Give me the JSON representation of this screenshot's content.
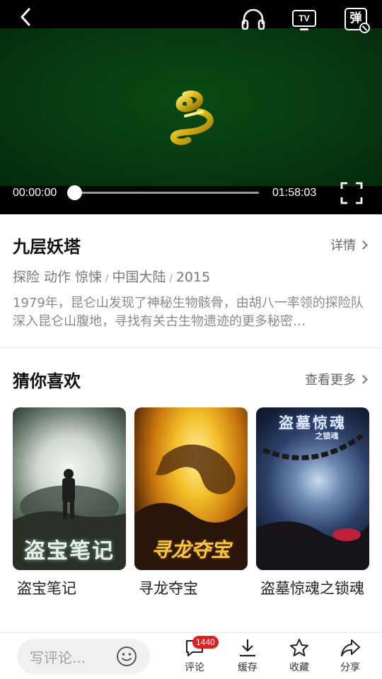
{
  "player": {
    "current_time": "00:00:00",
    "duration": "01:58:03",
    "progress": 0,
    "tv_label": "TV",
    "danmaku_label": "弹"
  },
  "movie": {
    "title": "九层妖塔",
    "detail_link": "详情",
    "genres": [
      "探险",
      "动作",
      "惊悚"
    ],
    "region": "中国大陆",
    "year": "2015",
    "description": "1979年，昆仑山发现了神秘生物骸骨，由胡八一率领的探险队深入昆仑山腹地，寻找有关古生物遗迹的更多秘密…"
  },
  "recommend": {
    "title": "猜你喜欢",
    "more_link": "查看更多",
    "items": [
      {
        "name": "盗宝笔记",
        "poster_text": "盗宝笔记"
      },
      {
        "name": "寻龙夺宝",
        "poster_text": "寻龙夺宝"
      },
      {
        "name": "盗墓惊魂之锁魂",
        "poster_text": "盗墓惊魂",
        "poster_subtext": "之锁魂"
      }
    ]
  },
  "bottom_bar": {
    "comment_placeholder": "写评论...",
    "actions": [
      {
        "label": "评论",
        "icon": "comment-icon",
        "badge": "1440"
      },
      {
        "label": "缓存",
        "icon": "download-icon"
      },
      {
        "label": "收藏",
        "icon": "star-icon"
      },
      {
        "label": "分享",
        "icon": "share-icon"
      }
    ]
  },
  "colors": {
    "badge": "#e02020",
    "video_bg": "#073a10",
    "logo_gold": "#d4b010"
  }
}
